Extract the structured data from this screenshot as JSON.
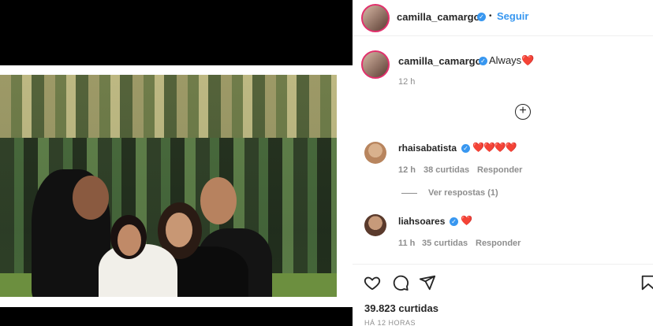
{
  "post": {
    "username": "camilla_camargo",
    "follow_label": "Seguir",
    "dot": "•",
    "caption_text": "Always",
    "caption_emoji": "❤️",
    "caption_time": "12 h",
    "likes": "39.823 curtidas",
    "posted_ago": "HÁ 12 HORAS"
  },
  "comments": [
    {
      "username": "rhaisabatista",
      "text": "❤️❤️❤️❤️",
      "time": "12 h",
      "likes": "38 curtidas",
      "reply_label": "Responder",
      "view_replies": "Ver respostas (1)"
    },
    {
      "username": "liahsoares",
      "text": "❤️",
      "time": "11 h",
      "likes": "35 curtidas",
      "reply_label": "Responder"
    }
  ],
  "icons": {
    "verified": "✓",
    "add_comment": "+",
    "like": "heart-icon",
    "comment": "comment-icon",
    "share": "share-icon",
    "save": "bookmark-icon"
  },
  "colors": {
    "link_blue": "#3897f0",
    "heart_red": "#ed4956",
    "story_ring": "#e1306c"
  }
}
